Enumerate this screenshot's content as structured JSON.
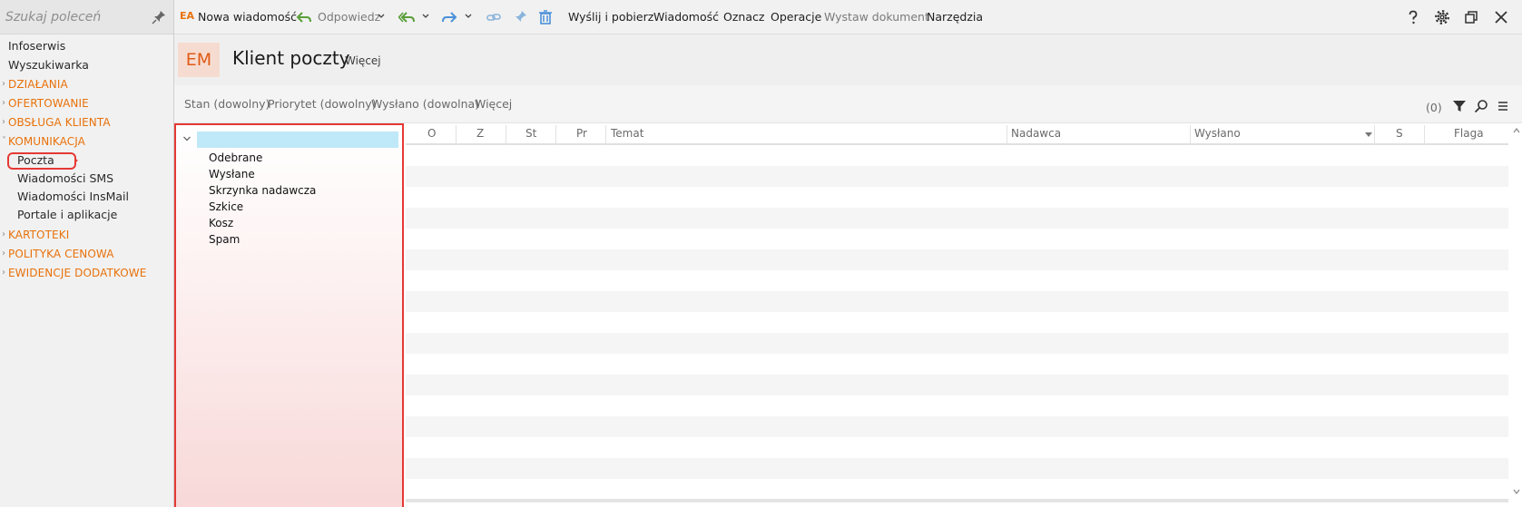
{
  "search": {
    "placeholder": "Szukaj poleceń"
  },
  "sidebar": {
    "items": [
      {
        "label": "Infoserwis"
      },
      {
        "label": "Wyszukiwarka"
      },
      {
        "label": "DZIAŁANIA"
      },
      {
        "label": "OFERTOWANIE"
      },
      {
        "label": "OBSŁUGA KLIENTA"
      },
      {
        "label": "KOMUNIKACJA"
      },
      {
        "label": "Poczta"
      },
      {
        "label": "Wiadomości SMS"
      },
      {
        "label": "Wiadomości InsMail"
      },
      {
        "label": "Portale i aplikacje"
      },
      {
        "label": "KARTOTEKI"
      },
      {
        "label": "POLITYKA CENOWA"
      },
      {
        "label": "EWIDENCJE DODATKOWE"
      }
    ],
    "active_item": "Poczta"
  },
  "toolbar": {
    "app_badge": "EA",
    "new_message": "Nowa wiadomość",
    "reply": "Odpowiedz",
    "send_receive": "Wyślij i pobierz",
    "message": "Wiadomość",
    "mark": "Oznacz",
    "operations": "Operacje",
    "issue_document": "Wystaw dokument",
    "tools": "Narzędzia"
  },
  "header": {
    "badge": "EM",
    "title": "Klient poczty",
    "more": "Więcej"
  },
  "filters": {
    "items": [
      "Stan (dowolny)",
      "Priorytet (dowolny)",
      "Wysłano (dowolna)",
      "Więcej"
    ],
    "count": "(0)"
  },
  "folders": {
    "root_label": "",
    "items": [
      "Odebrane",
      "Wysłane",
      "Skrzynka nadawcza",
      "Szkice",
      "Kosz",
      "Spam"
    ]
  },
  "grid": {
    "columns": [
      "O",
      "Z",
      "St",
      "Pr",
      "Temat",
      "Nadawca",
      "Wysłano",
      "S",
      "Flaga"
    ],
    "sorted_column": "Wysłano",
    "rows": []
  },
  "colors": {
    "accent": "#e8710a",
    "highlight": "#e53935",
    "icon_blue": "#4a90d9",
    "icon_green": "#5a9e3a"
  }
}
